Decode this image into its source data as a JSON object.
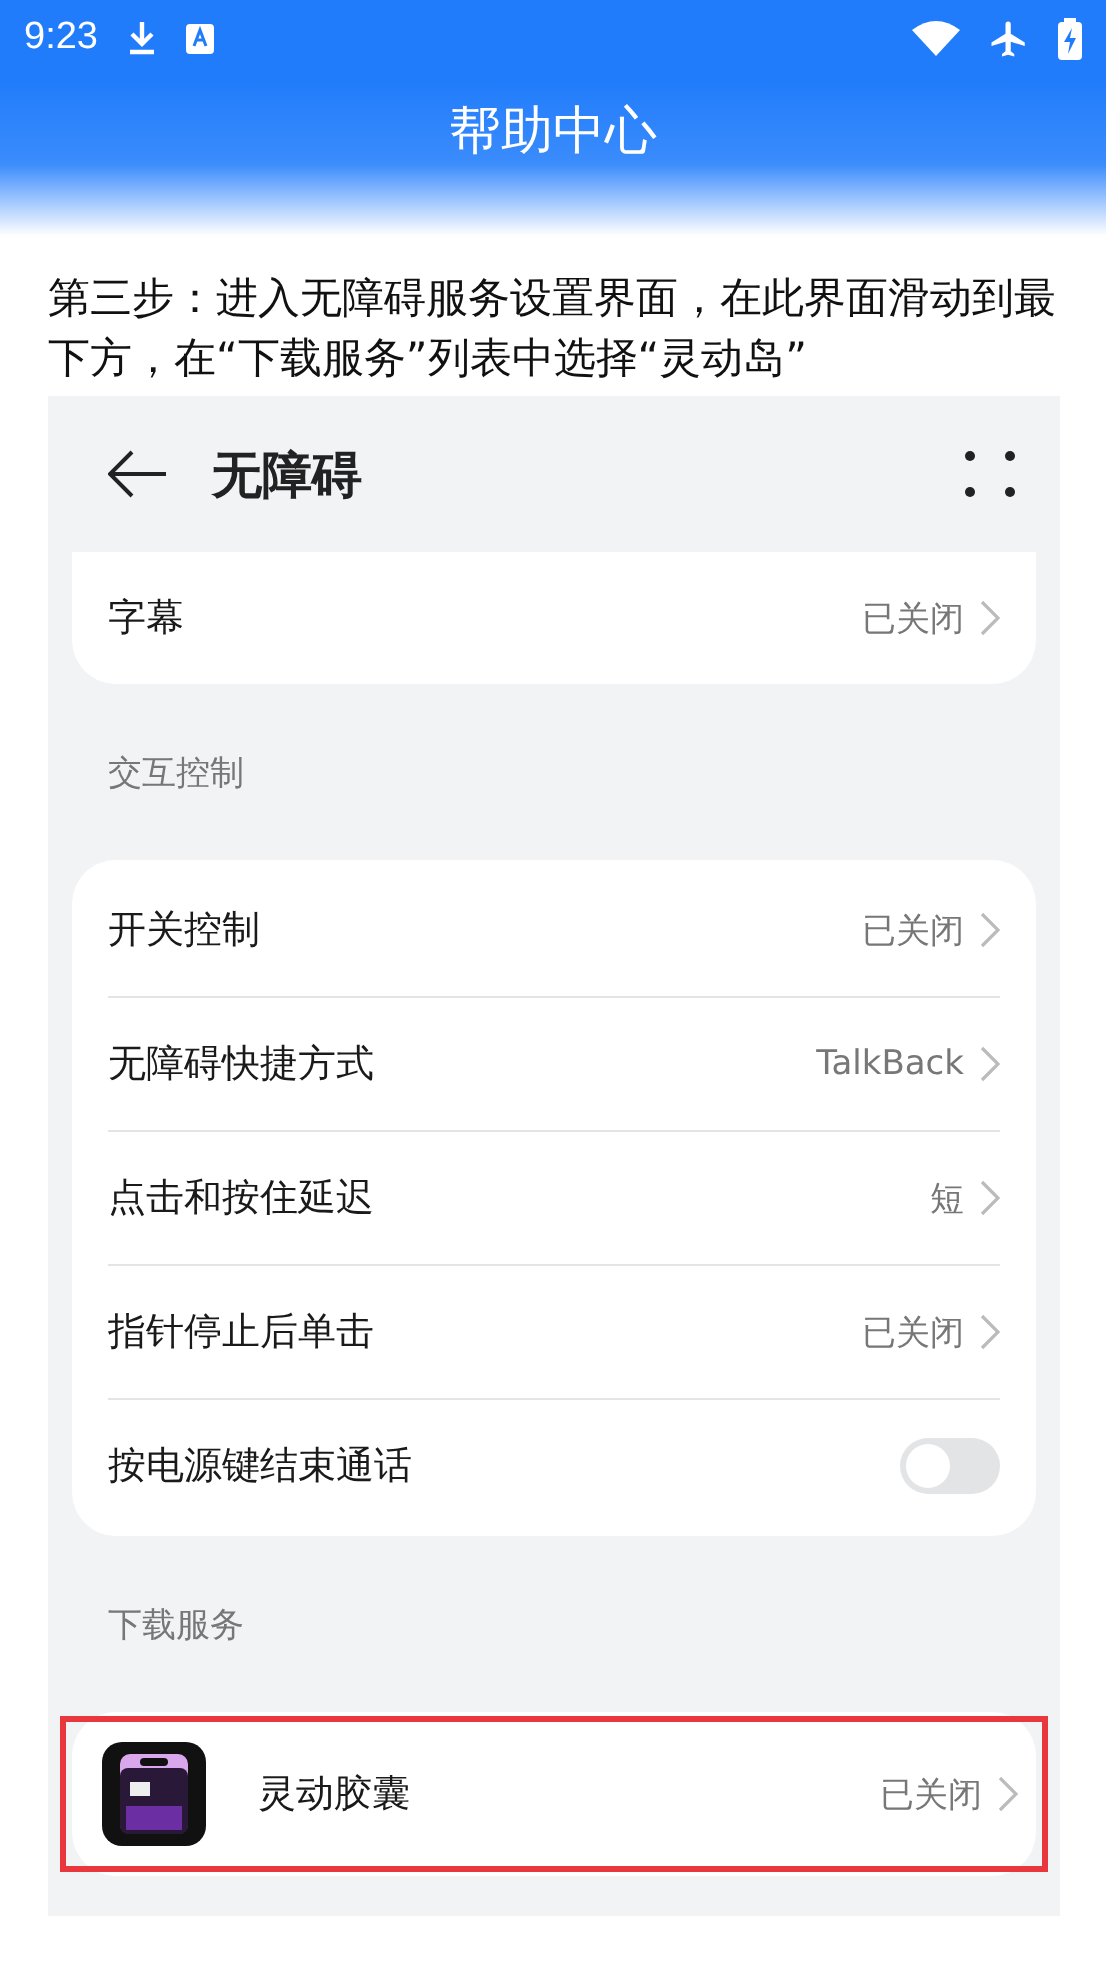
{
  "status_bar": {
    "time": "9:23"
  },
  "header": {
    "title": "帮助中心"
  },
  "instruction": "第三步：进入无障碍服务设置界面，在此界面滑动到最下方，在“下载服务”列表中选择“灵动岛”",
  "screenshot": {
    "title": "无障碍",
    "top_card": [
      {
        "kind": "link",
        "label": "字幕",
        "value": "已关闭"
      }
    ],
    "sections": [
      {
        "heading": "交互控制",
        "rows": [
          {
            "kind": "link",
            "label": "开关控制",
            "value": "已关闭"
          },
          {
            "kind": "link",
            "label": "无障碍快捷方式",
            "value": "TalkBack"
          },
          {
            "kind": "link",
            "label": "点击和按住延迟",
            "value": "短"
          },
          {
            "kind": "link",
            "label": "指针停止后单击",
            "value": "已关闭"
          },
          {
            "kind": "switch",
            "label": "按电源键结束通话",
            "on": false
          }
        ]
      },
      {
        "heading": "下载服务",
        "rows": [
          {
            "kind": "app",
            "label": "灵动胶囊",
            "value": "已关闭",
            "highlighted": true
          }
        ]
      }
    ]
  }
}
